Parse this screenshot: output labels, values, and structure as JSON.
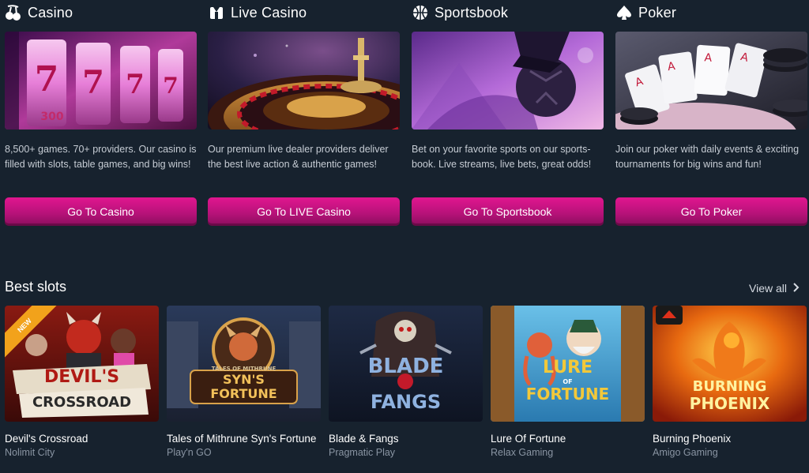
{
  "categories": [
    {
      "title": "Casino",
      "icon": "cherries-icon",
      "description": "8,500+ games. 70+ providers. Our casino is filled with slots, table games, and big wins!",
      "button": "Go To Casino"
    },
    {
      "title": "Live Casino",
      "icon": "live-dealer-icon",
      "description": "Our premium live dealer providers deliver the best live action & authentic games!",
      "button": "Go To LIVE Casino"
    },
    {
      "title": "Sportsbook",
      "icon": "basketball-icon",
      "description": "Bet on your favorite sports on our sports-book. Live streams, live bets, great odds!",
      "button": "Go To Sportsbook"
    },
    {
      "title": "Poker",
      "icon": "spade-icon",
      "description": "Join our poker with daily events & exciting tournaments for big wins and fun!",
      "button": "Go To Poker"
    }
  ],
  "best_slots": {
    "title": "Best slots",
    "view_all": "View all",
    "items": [
      {
        "name": "Devil's Crossroad",
        "provider": "Nolimit City",
        "badge": "NEW",
        "art_line1": "DEVIL'S",
        "art_line2": "CROSSROAD"
      },
      {
        "name": "Tales of Mithrune Syn's Fortune",
        "provider": "Play'n GO",
        "art_line1": "SYN'S",
        "art_line2": "FORTUNE",
        "art_small": "TALES OF MITHRUNE"
      },
      {
        "name": "Blade & Fangs",
        "provider": "Pragmatic Play",
        "art_line1": "BLADE",
        "art_line2": "FANGS"
      },
      {
        "name": "Lure Of Fortune",
        "provider": "Relax Gaming",
        "art_line1": "LURE",
        "art_line2": "FORTUNE",
        "art_small": "OF"
      },
      {
        "name": "Burning Phoenix",
        "provider": "Amigo Gaming",
        "art_line1": "BURNING",
        "art_line2": "PHOENIX"
      }
    ]
  }
}
